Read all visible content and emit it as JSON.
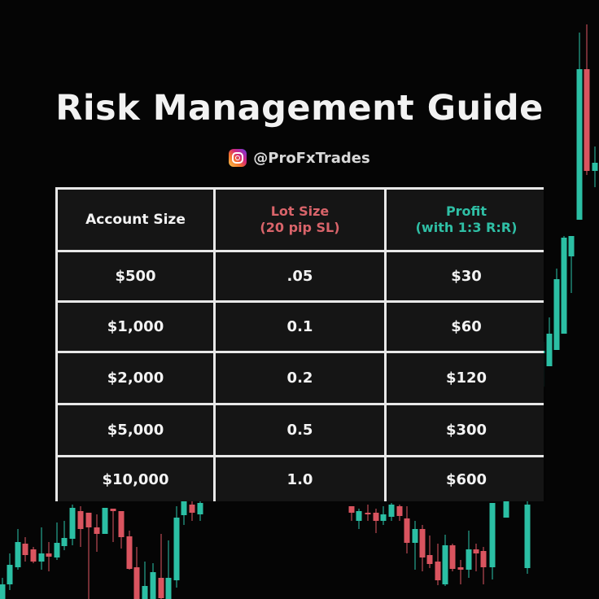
{
  "title": "Risk Management Guide",
  "social": {
    "icon": "instagram-icon",
    "handle": "@ProFxTrades"
  },
  "colors": {
    "background": "#050505",
    "text": "#f3f3f3",
    "lot_header": "#d9646a",
    "profit_header": "#2fbfa5",
    "bull_candle": "#2bbfa4",
    "bear_candle": "#d9545f",
    "table_border": "#e8e8e8"
  },
  "table": {
    "headers": [
      {
        "line1": "Account Size",
        "line2": ""
      },
      {
        "line1": "Lot Size",
        "line2": "(20 pip SL)"
      },
      {
        "line1": "Profit",
        "line2": "(with 1:3 R:R)"
      }
    ],
    "rows": [
      {
        "account": "$500",
        "lot": ".05",
        "profit": "$30"
      },
      {
        "account": "$1,000",
        "lot": "0.1",
        "profit": "$60"
      },
      {
        "account": "$2,000",
        "lot": "0.2",
        "profit": "$120"
      },
      {
        "account": "$5,000",
        "lot": "0.5",
        "profit": "$300"
      },
      {
        "account": "$10,000",
        "lot": "1.0",
        "profit": "$600"
      }
    ]
  }
}
